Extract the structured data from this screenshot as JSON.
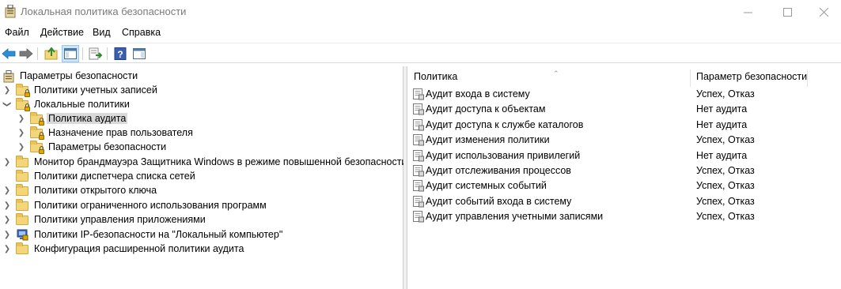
{
  "window": {
    "title": "Локальная политика безопасности"
  },
  "menu": [
    "Файл",
    "Действие",
    "Вид",
    "Справка"
  ],
  "tree": {
    "root": "Параметры безопасности",
    "items": [
      {
        "label": "Политики учетных записей",
        "expanded": false
      },
      {
        "label": "Локальные политики",
        "expanded": true
      },
      {
        "label": "Политика аудита",
        "selected": true
      },
      {
        "label": "Назначение прав пользователя"
      },
      {
        "label": "Параметры безопасности"
      },
      {
        "label": "Монитор брандмауэра Защитника Windows в режиме повышенной безопасности"
      },
      {
        "label": "Политики диспетчера списка сетей"
      },
      {
        "label": "Политики открытого ключа"
      },
      {
        "label": "Политики ограниченного использования программ"
      },
      {
        "label": "Политики управления приложениями"
      },
      {
        "label": "Политики IP-безопасности на \"Локальный компьютер\""
      },
      {
        "label": "Конфигурация расширенной политики аудита"
      }
    ]
  },
  "list": {
    "columns": [
      "Политика",
      "Параметр безопасности"
    ],
    "rows": [
      {
        "policy": "Аудит входа в систему",
        "setting": "Успех, Отказ"
      },
      {
        "policy": "Аудит доступа к объектам",
        "setting": "Нет аудита"
      },
      {
        "policy": "Аудит доступа к службе каталогов",
        "setting": "Нет аудита"
      },
      {
        "policy": "Аудит изменения политики",
        "setting": "Успех, Отказ"
      },
      {
        "policy": "Аудит использования привилегий",
        "setting": "Нет аудита"
      },
      {
        "policy": "Аудит отслеживания процессов",
        "setting": "Успех, Отказ"
      },
      {
        "policy": "Аудит системных событий",
        "setting": "Успех, Отказ"
      },
      {
        "policy": "Аудит событий входа в систему",
        "setting": "Успех, Отказ"
      },
      {
        "policy": "Аудит управления учетными записями",
        "setting": "Успех, Отказ"
      }
    ]
  },
  "colors": {
    "selection": "#d9d9d9",
    "folder": "#f4d67a",
    "nav_arrow": "#2b8fd6"
  }
}
